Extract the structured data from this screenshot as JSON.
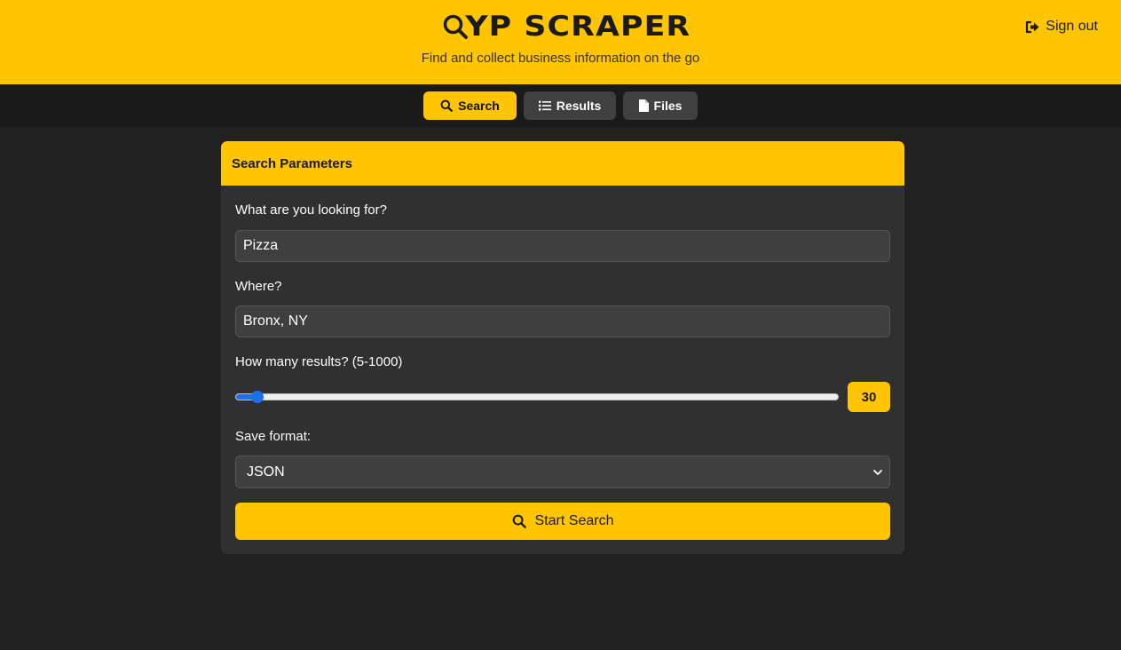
{
  "header": {
    "title": "YP SCRAPER",
    "subtitle": "Find and collect business information on the go",
    "sign_out_label": "Sign out",
    "background_color": "#ffc501"
  },
  "nav": {
    "tabs": [
      {
        "label": "Search",
        "icon": "search-icon",
        "active": true
      },
      {
        "label": "Results",
        "icon": "list-icon",
        "active": false
      },
      {
        "label": "Files",
        "icon": "file-icon",
        "active": false
      }
    ]
  },
  "form": {
    "card_title": "Search Parameters",
    "query_label": "What are you looking for?",
    "query_value": "Pizza",
    "location_label": "Where?",
    "location_value": "Bronx, NY",
    "results_label": "How many results? (5-1000)",
    "results_min": 5,
    "results_max": 1000,
    "results_value": 30,
    "results_value_text": "30",
    "format_label": "Save format:",
    "format_value": "JSON",
    "submit_label": "Start Search"
  },
  "colors": {
    "accent": "#ffc501",
    "slider": "#1f6feb",
    "background": "#212121",
    "card": "#303030"
  }
}
